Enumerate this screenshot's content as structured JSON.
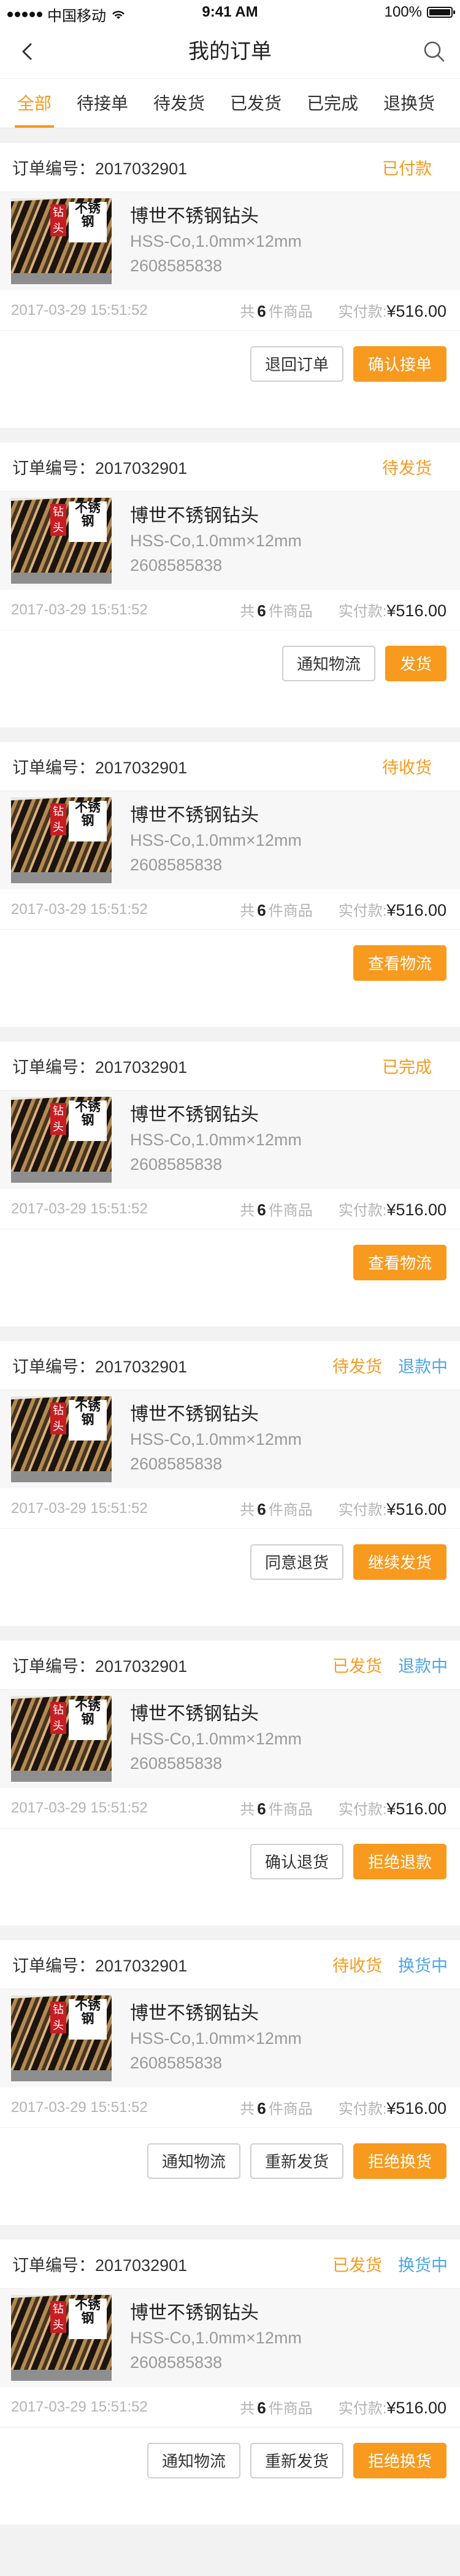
{
  "statusbar": {
    "carrier": "中国移动",
    "time": "9:41 AM",
    "battery": "100%"
  },
  "navbar": {
    "title": "我的订单"
  },
  "tabs": [
    "全部",
    "待接单",
    "待发货",
    "已发货",
    "已完成",
    "退换货"
  ],
  "colors": {
    "accent": "#f79a1e",
    "info": "#4ea5e8"
  },
  "orders": [
    {
      "no_label": "订单编号：2017032901",
      "status": "已付款",
      "extra": "",
      "product": {
        "name": "博世不锈钢钻头",
        "spec": "HSS-Co,1.0mm×12mm",
        "code": "2608585838",
        "tag": "钻头",
        "tag2": "不锈钢"
      },
      "date": "2017-03-29 15:51:52",
      "count_prefix": "共",
      "count": "6",
      "count_suffix": "件商品",
      "paid_label": "实付款:",
      "price": "¥516.00",
      "buttons": [
        {
          "label": "退回订单",
          "style": "outline"
        },
        {
          "label": "确认接单",
          "style": "primary"
        }
      ]
    },
    {
      "no_label": "订单编号：2017032901",
      "status": "待发货",
      "extra": "",
      "product": {
        "name": "博世不锈钢钻头",
        "spec": "HSS-Co,1.0mm×12mm",
        "code": "2608585838",
        "tag": "钻头",
        "tag2": "不锈钢"
      },
      "date": "2017-03-29 15:51:52",
      "count_prefix": "共",
      "count": "6",
      "count_suffix": "件商品",
      "paid_label": "实付款:",
      "price": "¥516.00",
      "buttons": [
        {
          "label": "通知物流",
          "style": "outline"
        },
        {
          "label": "发货",
          "style": "primary"
        }
      ]
    },
    {
      "no_label": "订单编号：2017032901",
      "status": "待收货",
      "extra": "",
      "product": {
        "name": "博世不锈钢钻头",
        "spec": "HSS-Co,1.0mm×12mm",
        "code": "2608585838",
        "tag": "钻头",
        "tag2": "不锈钢"
      },
      "date": "2017-03-29 15:51:52",
      "count_prefix": "共",
      "count": "6",
      "count_suffix": "件商品",
      "paid_label": "实付款:",
      "price": "¥516.00",
      "buttons": [
        {
          "label": "查看物流",
          "style": "primary"
        }
      ]
    },
    {
      "no_label": "订单编号：2017032901",
      "status": "已完成",
      "extra": "",
      "product": {
        "name": "博世不锈钢钻头",
        "spec": "HSS-Co,1.0mm×12mm",
        "code": "2608585838",
        "tag": "钻头",
        "tag2": "不锈钢"
      },
      "date": "2017-03-29 15:51:52",
      "count_prefix": "共",
      "count": "6",
      "count_suffix": "件商品",
      "paid_label": "实付款:",
      "price": "¥516.00",
      "buttons": [
        {
          "label": "查看物流",
          "style": "primary"
        }
      ]
    },
    {
      "no_label": "订单编号：2017032901",
      "status": "待发货",
      "extra": "退款中",
      "product": {
        "name": "博世不锈钢钻头",
        "spec": "HSS-Co,1.0mm×12mm",
        "code": "2608585838",
        "tag": "钻头",
        "tag2": "不锈钢"
      },
      "date": "2017-03-29 15:51:52",
      "count_prefix": "共",
      "count": "6",
      "count_suffix": "件商品",
      "paid_label": "实付款:",
      "price": "¥516.00",
      "buttons": [
        {
          "label": "同意退货",
          "style": "outline"
        },
        {
          "label": "继续发货",
          "style": "primary"
        }
      ]
    },
    {
      "no_label": "订单编号：2017032901",
      "status": "已发货",
      "extra": "退款中",
      "product": {
        "name": "博世不锈钢钻头",
        "spec": "HSS-Co,1.0mm×12mm",
        "code": "2608585838",
        "tag": "钻头",
        "tag2": "不锈钢"
      },
      "date": "2017-03-29 15:51:52",
      "count_prefix": "共",
      "count": "6",
      "count_suffix": "件商品",
      "paid_label": "实付款:",
      "price": "¥516.00",
      "buttons": [
        {
          "label": "确认退货",
          "style": "outline"
        },
        {
          "label": "拒绝退款",
          "style": "primary"
        }
      ]
    },
    {
      "no_label": "订单编号：2017032901",
      "status": "待收货",
      "extra": "换货中",
      "product": {
        "name": "博世不锈钢钻头",
        "spec": "HSS-Co,1.0mm×12mm",
        "code": "2608585838",
        "tag": "钻头",
        "tag2": "不锈钢"
      },
      "date": "2017-03-29 15:51:52",
      "count_prefix": "共",
      "count": "6",
      "count_suffix": "件商品",
      "paid_label": "实付款:",
      "price": "¥516.00",
      "buttons": [
        {
          "label": "通知物流",
          "style": "outline"
        },
        {
          "label": "重新发货",
          "style": "outline"
        },
        {
          "label": "拒绝换货",
          "style": "primary"
        }
      ]
    },
    {
      "no_label": "订单编号：2017032901",
      "status": "已发货",
      "extra": "换货中",
      "product": {
        "name": "博世不锈钢钻头",
        "spec": "HSS-Co,1.0mm×12mm",
        "code": "2608585838",
        "tag": "钻头",
        "tag2": "不锈钢"
      },
      "date": "2017-03-29 15:51:52",
      "count_prefix": "共",
      "count": "6",
      "count_suffix": "件商品",
      "paid_label": "实付款:",
      "price": "¥516.00",
      "buttons": [
        {
          "label": "通知物流",
          "style": "outline"
        },
        {
          "label": "重新发货",
          "style": "outline"
        },
        {
          "label": "拒绝换货",
          "style": "primary"
        }
      ]
    }
  ]
}
